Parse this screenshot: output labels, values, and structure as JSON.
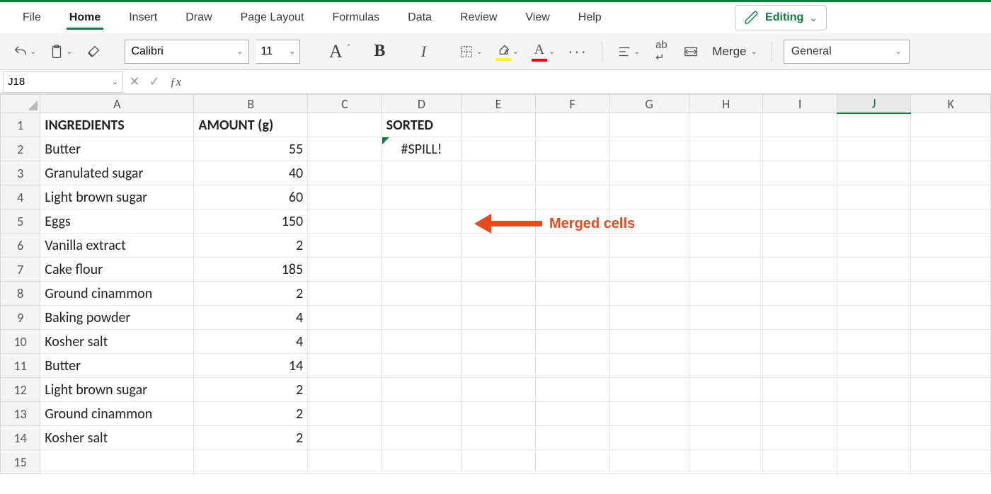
{
  "tabs": [
    "File",
    "Home",
    "Insert",
    "Draw",
    "Page Layout",
    "Formulas",
    "Data",
    "Review",
    "View",
    "Help"
  ],
  "active_tab": "Home",
  "editing_label": "Editing",
  "toolbar": {
    "font_name": "Calibri",
    "font_size": "11",
    "merge_label": "Merge",
    "number_format": "General"
  },
  "name_box": "J18",
  "formula_value": "",
  "columns": [
    "A",
    "B",
    "C",
    "D",
    "E",
    "F",
    "G",
    "H",
    "I",
    "J",
    "K"
  ],
  "selected_column": "J",
  "row_count": 15,
  "annotation": "Merged cells",
  "chart_data": {
    "type": "table",
    "headers": {
      "A": "INGREDIENTS",
      "B": "AMOUNT (g)",
      "D": "SORTED"
    },
    "spill_error": "#SPILL!",
    "rows": [
      {
        "ingredient": "Butter",
        "amount": 55
      },
      {
        "ingredient": "Granulated sugar",
        "amount": 40
      },
      {
        "ingredient": "Light brown sugar",
        "amount": 60
      },
      {
        "ingredient": "Eggs",
        "amount": 150
      },
      {
        "ingredient": "Vanilla extract",
        "amount": 2
      },
      {
        "ingredient": "Cake flour",
        "amount": 185
      },
      {
        "ingredient": "Ground cinammon",
        "amount": 2
      },
      {
        "ingredient": "Baking powder",
        "amount": 4
      },
      {
        "ingredient": "Kosher salt",
        "amount": 4
      },
      {
        "ingredient": "Butter",
        "amount": 14
      },
      {
        "ingredient": "Light brown sugar",
        "amount": 2
      },
      {
        "ingredient": "Ground cinammon",
        "amount": 2
      },
      {
        "ingredient": "Kosher salt",
        "amount": 2
      }
    ]
  }
}
